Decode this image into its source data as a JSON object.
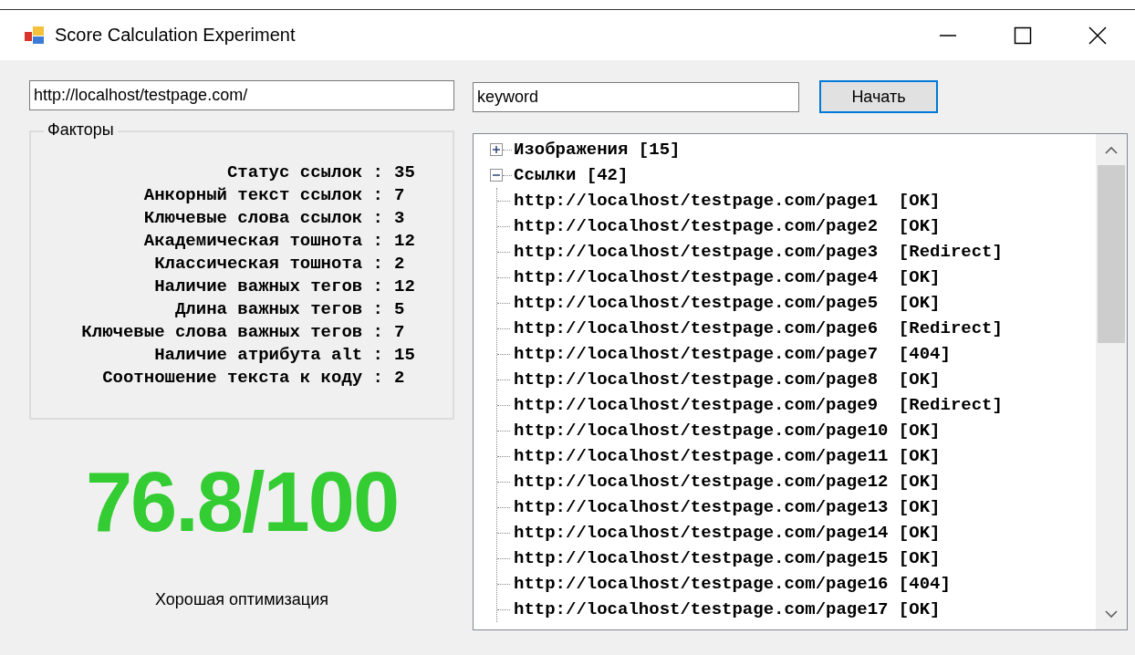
{
  "window": {
    "title": "Score Calculation Experiment"
  },
  "url_field": {
    "value": "http://localhost/testpage.com/"
  },
  "keyword_field": {
    "value": "keyword"
  },
  "start_button": {
    "label": "Начать"
  },
  "factors": {
    "title": "Факторы",
    "rows": [
      {
        "label": "Статус ссылок :",
        "value": "35"
      },
      {
        "label": "Анкорный текст ссылок :",
        "value": "7"
      },
      {
        "label": "Ключевые слова ссылок :",
        "value": "3"
      },
      {
        "label": "Академическая тошнота :",
        "value": "12"
      },
      {
        "label": "Классическая тошнота :",
        "value": "2"
      },
      {
        "label": "Наличие важных тегов :",
        "value": "12"
      },
      {
        "label": "Длина важных тегов :",
        "value": "5"
      },
      {
        "label": "Ключевые слова важных тегов :",
        "value": "7"
      },
      {
        "label": "Наличие атрибута alt :",
        "value": "15"
      },
      {
        "label": "Соотношение текста к коду :",
        "value": "2"
      }
    ]
  },
  "score": {
    "value": "76.8/100",
    "verdict": "Хорошая оптимизация"
  },
  "tree": {
    "nodes": [
      {
        "label": "Изображения [15]",
        "expanded": false
      },
      {
        "label": "Ссылки [42]",
        "expanded": true,
        "children": [
          {
            "label": "http://localhost/testpage.com/page1  [OK]"
          },
          {
            "label": "http://localhost/testpage.com/page2  [OK]"
          },
          {
            "label": "http://localhost/testpage.com/page3  [Redirect]"
          },
          {
            "label": "http://localhost/testpage.com/page4  [OK]"
          },
          {
            "label": "http://localhost/testpage.com/page5  [OK]"
          },
          {
            "label": "http://localhost/testpage.com/page6  [Redirect]"
          },
          {
            "label": "http://localhost/testpage.com/page7  [404]"
          },
          {
            "label": "http://localhost/testpage.com/page8  [OK]"
          },
          {
            "label": "http://localhost/testpage.com/page9  [Redirect]"
          },
          {
            "label": "http://localhost/testpage.com/page10 [OK]"
          },
          {
            "label": "http://localhost/testpage.com/page11 [OK]"
          },
          {
            "label": "http://localhost/testpage.com/page12 [OK]"
          },
          {
            "label": "http://localhost/testpage.com/page13 [OK]"
          },
          {
            "label": "http://localhost/testpage.com/page14 [OK]"
          },
          {
            "label": "http://localhost/testpage.com/page15 [OK]"
          },
          {
            "label": "http://localhost/testpage.com/page16 [404]"
          },
          {
            "label": "http://localhost/testpage.com/page17 [OK]"
          }
        ]
      }
    ]
  }
}
